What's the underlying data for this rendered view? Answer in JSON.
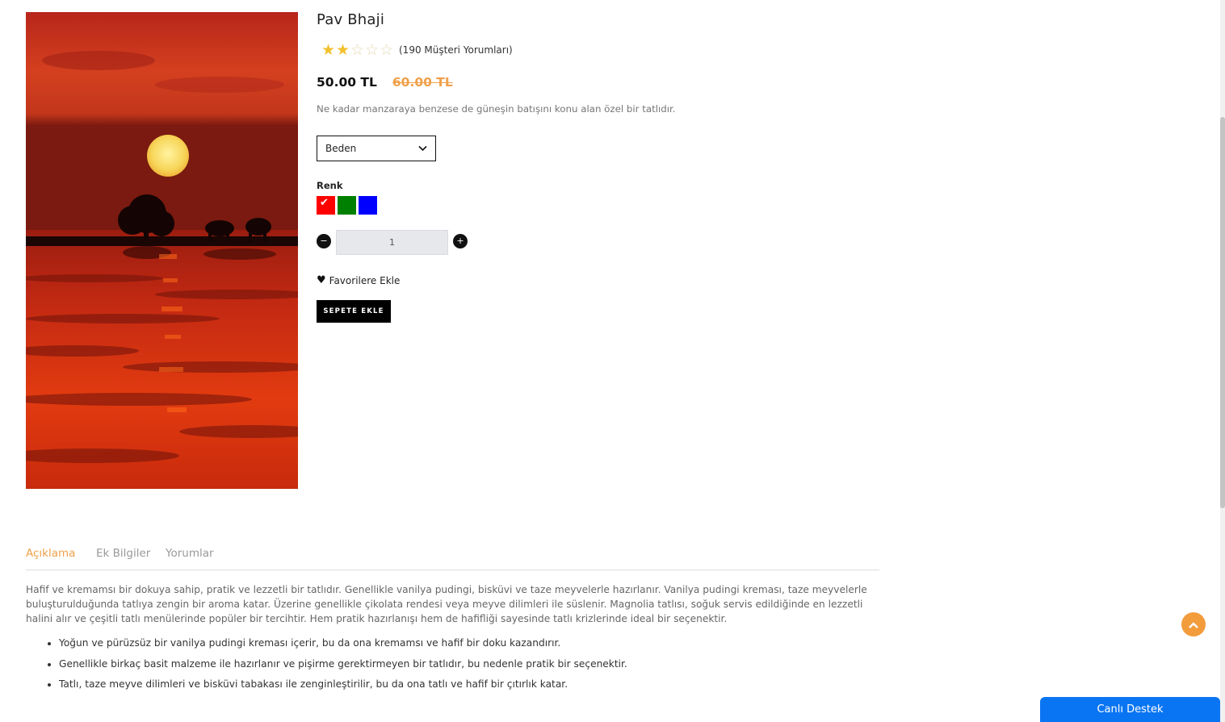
{
  "product": {
    "title": "Pav Bhaji",
    "rating_stars": 2,
    "rating_max": 5,
    "rating_text": "(190 Müşteri Yorumları)",
    "price_now": "50.00 TL",
    "price_old": "60.00 TL",
    "short_description": "Ne kadar manzaraya benzese de güneşin batışını konu alan özel bir tatlıdır.",
    "size_select": "Beden",
    "color_label": "Renk",
    "colors": [
      "#ff0000",
      "#008000",
      "#0000ff"
    ],
    "selected_color": "#ff0000",
    "quantity": "1",
    "favorite_label": "Favorilere Ekle",
    "cart_label": "SEPETE EKLE"
  },
  "tabs": [
    "Açıklama",
    "Ek Bilgiler",
    "Yorumlar"
  ],
  "active_tab": "Açıklama",
  "description": "Hafif ve kremamsı bir dokuya sahip, pratik ve lezzetli bir tatlıdır. Genellikle vanilya pudingi, bisküvi ve taze meyvelerle hazırlanır. Vanilya pudingi kreması, taze meyvelerle buluşturulduğunda tatlıya zengin bir aroma katar. Üzerine genellikle çikolata rendesi veya meyve dilimleri ile süslenir. Magnolia tatlısı, soğuk servis edildiğinde en lezzetli halini alır ve çeşitli tatlı menülerinde popüler bir tercihtir. Hem pratik hazırlanışı hem de hafifliği sayesinde tatlı krizlerinde ideal bir seçenektir.",
  "bullets": [
    "Yoğun ve pürüzsüz bir vanilya pudingi kreması içerir, bu da ona kremamsı ve hafif bir doku kazandırır.",
    "Genellikle birkaç basit malzeme ile hazırlanır ve pişirme gerektirmeyen bir tatlıdır, bu nedenle pratik bir seçenektir.",
    "Tatlı, taze meyve dilimleri ve bisküvi tabakası ile zenginleştirilir, bu da ona tatlı ve hafif bir çıtırlık katar."
  ],
  "live_support": "Canlı Destek",
  "accent_color": "#f0a04b"
}
